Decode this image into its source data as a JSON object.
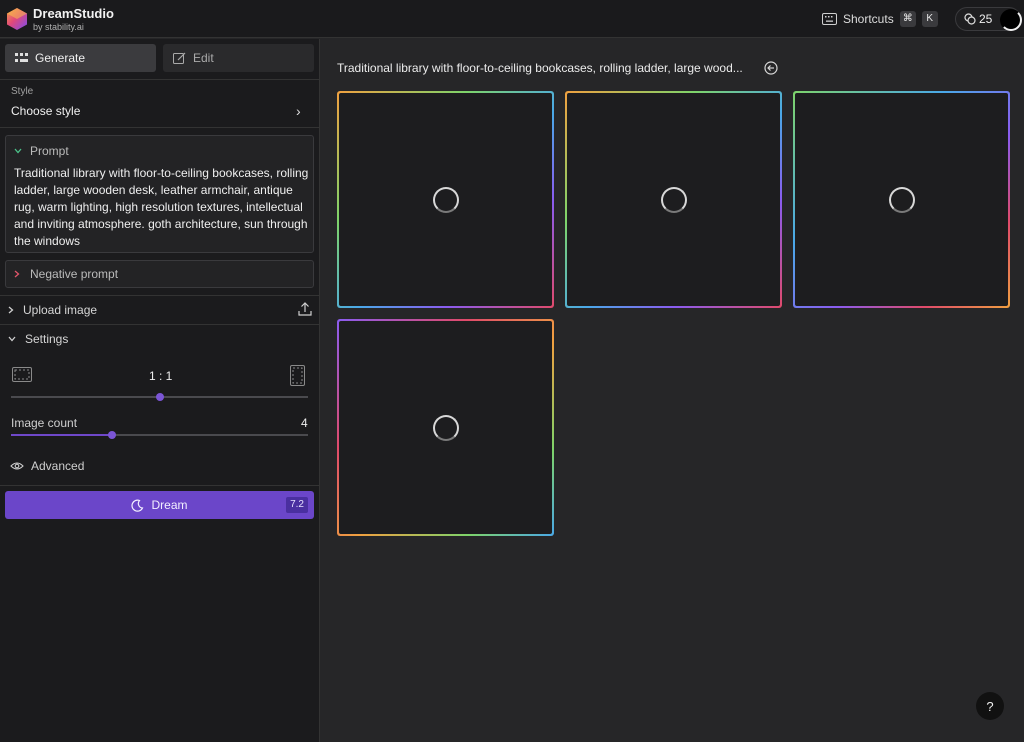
{
  "header": {
    "brand": "DreamStudio",
    "brand_sub": "by stability.ai",
    "shortcuts_label": "Shortcuts",
    "shortcut_keys": [
      "⌘",
      "K"
    ],
    "credits": "25"
  },
  "sidebar": {
    "tabs": [
      {
        "label": "Generate",
        "icon": "grid-icon",
        "active": true
      },
      {
        "label": "Edit",
        "icon": "edit-icon",
        "active": false
      }
    ],
    "style": {
      "label": "Style",
      "value": "Choose style"
    },
    "prompt": {
      "label": "Prompt",
      "text": "Traditional library with floor-to-ceiling bookcases, rolling ladder, large wooden desk, leather armchair, antique rug, warm lighting, high resolution textures, intellectual and inviting atmosphere. goth architecture, sun through the windows"
    },
    "negative_prompt": {
      "label": "Negative prompt"
    },
    "upload_image": {
      "label": "Upload image"
    },
    "settings": {
      "label": "Settings",
      "aspect_ratio": "1 : 1",
      "aspect_slider_level": 0.5,
      "image_count_label": "Image count",
      "image_count": "4",
      "image_count_level": 0.34
    },
    "advanced": {
      "label": "Advanced"
    },
    "dream": {
      "label": "Dream",
      "cost": "7.2"
    }
  },
  "main": {
    "title": "Traditional library with floor-to-ceiling bookcases, rolling ladder, large wood...",
    "tiles_count": 4
  },
  "help": {
    "label": "?"
  },
  "colors": {
    "accent": "#6b46c9",
    "background": "#262628",
    "sidebar": "#1b1b1d"
  }
}
